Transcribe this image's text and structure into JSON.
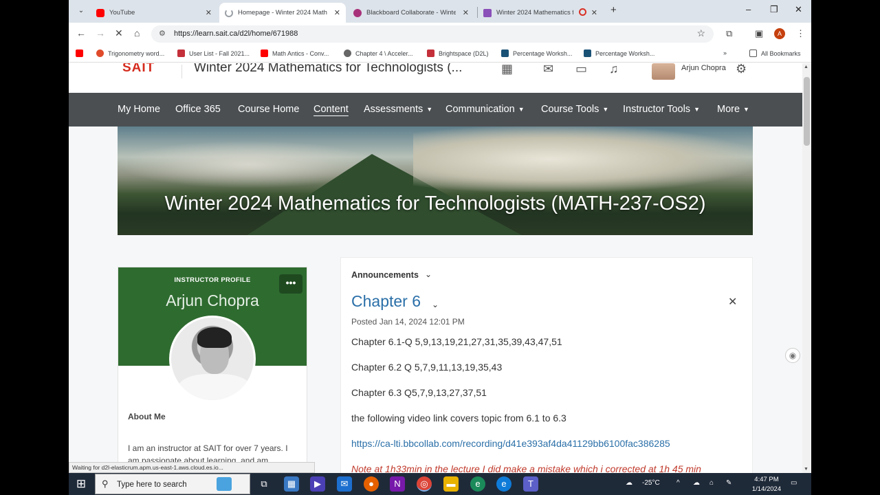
{
  "browser": {
    "tabs": [
      {
        "title": "YouTube",
        "favicon_color": "#ff0000"
      },
      {
        "title": "Homepage - Winter 2024 Math",
        "favicon_color": "#9aa0a6"
      },
      {
        "title": "Blackboard Collaborate - Winte",
        "favicon_color": "#a8327a"
      },
      {
        "title": "Winter 2024 Mathematics f",
        "favicon_color": "#8a4fb8"
      }
    ],
    "url": "https://learn.sait.ca/d2l/home/671988",
    "profile_initial": "A",
    "bookmarks": [
      {
        "label": "",
        "color": "#ff0000"
      },
      {
        "label": "Trigonometry word...",
        "color": "#e04b2c"
      },
      {
        "label": "User List - Fall 2021...",
        "color": "#c4303a"
      },
      {
        "label": "Math Antics - Conv...",
        "color": "#ff0000"
      },
      {
        "label": "Chapter 4 \\ Acceler...",
        "color": "#666666"
      },
      {
        "label": "Brightspace (D2L)",
        "color": "#c4303a"
      },
      {
        "label": "Percentage Worksh...",
        "color": "#1a5276"
      },
      {
        "label": "Percentage Worksh...",
        "color": "#1a5276"
      }
    ],
    "all_bookmarks": "All Bookmarks",
    "status_text": "Waiting for d2l-elasticrum.apm.us-east-1.aws.cloud.es.io..."
  },
  "header": {
    "logo": "SAIT",
    "course_title": "Winter 2024 Mathematics for Technologists (...",
    "user_name": "Arjun Chopra"
  },
  "nav": {
    "items": [
      {
        "label": "My Home",
        "dropdown": false
      },
      {
        "label": "Office 365",
        "dropdown": false
      },
      {
        "label": "Course Home",
        "dropdown": false
      },
      {
        "label": "Content",
        "dropdown": false
      },
      {
        "label": "Assessments",
        "dropdown": true
      },
      {
        "label": "Communication",
        "dropdown": true
      },
      {
        "label": "Course Tools",
        "dropdown": true
      },
      {
        "label": "Instructor Tools",
        "dropdown": true
      },
      {
        "label": "More",
        "dropdown": true
      }
    ]
  },
  "banner": {
    "title": "Winter 2024 Mathematics for Technologists (MATH-237-OS2)"
  },
  "profile": {
    "label": "INSTRUCTOR PROFILE",
    "name": "Arjun Chopra",
    "more": "•••",
    "about_heading": "About Me",
    "bio": "I am an instructor  at SAIT  for over 7 years. I am passionate about learning, and am"
  },
  "announcements": {
    "heading": "Announcements",
    "item_title": "Chapter 6",
    "posted": "Posted Jan 14, 2024 12:01 PM",
    "lines": [
      "Chapter 6.1-Q 5,9,13,19,21,27,31,35,39,43,47,51",
      "Chapter 6.2 Q 5,7,9,11,13,19,35,43",
      "Chapter 6.3 Q5,7,9,13,27,37,51",
      "the following video link covers topic from 6.1 to 6.3"
    ],
    "link": "https://ca-lti.bbcollab.com/recording/d41e393af4da41129bb6100fac386285",
    "note": "Note at 1h33min in the lecture I did make a mistake which i corrected at 1h 45 min"
  },
  "taskbar": {
    "search_placeholder": "Type here to search",
    "temperature": "-25°C",
    "time": "4:47 PM",
    "date": "1/14/2024"
  }
}
